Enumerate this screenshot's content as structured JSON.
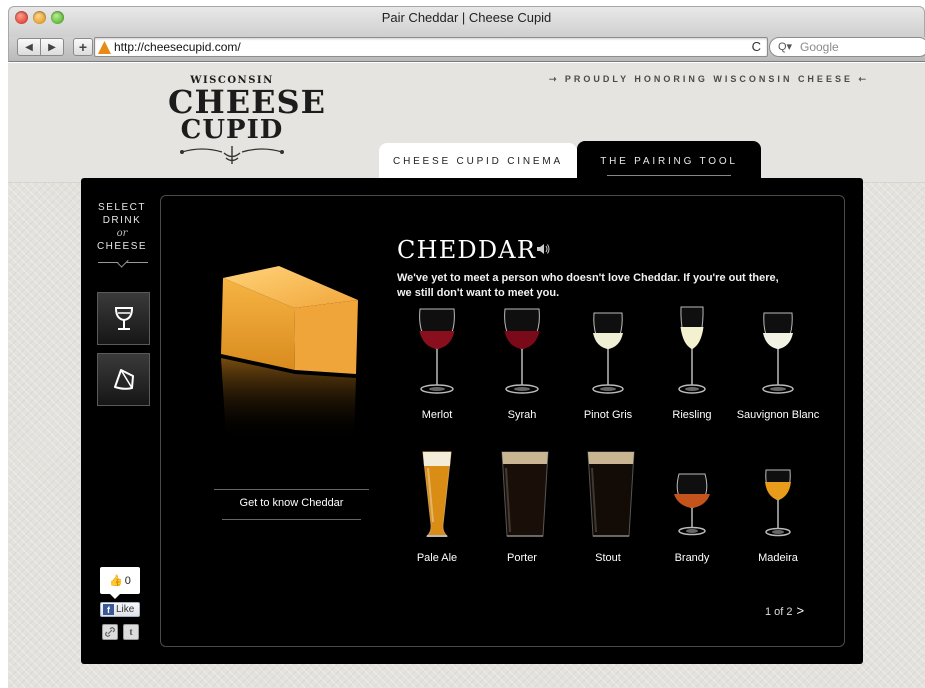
{
  "window": {
    "title": "Pair Cheddar | Cheese Cupid"
  },
  "browser": {
    "back_label": "◀",
    "forward_label": "▶",
    "add_label": "+",
    "url": "http://cheesecupid.com/",
    "reload_label": "C",
    "search_placeholder": "Google",
    "search_glyph": "Q▾"
  },
  "header": {
    "logo": {
      "line1": "WISCONSIN",
      "line2": "CHEESE",
      "line3": "CUPID"
    },
    "tagline": "PROUDLY HONORING WISCONSIN CHEESE",
    "tabs": [
      {
        "label": "CHEESE CUPID CINEMA",
        "active": false
      },
      {
        "label": "THE PAIRING TOOL",
        "active": true
      }
    ]
  },
  "sidebar": {
    "select_line1": "SELECT",
    "select_line2": "DRINK",
    "select_or": "or",
    "select_line3": "CHEESE",
    "buttons": [
      {
        "icon": "wine-glass-icon"
      },
      {
        "icon": "cheese-wedge-icon"
      }
    ],
    "social": {
      "like_count": "0",
      "like_label": "Like",
      "share_link_glyph": "🔗",
      "twitter_glyph": "t"
    }
  },
  "cheese": {
    "name": "CHEDDAR",
    "description": "We've yet to meet a person who doesn't love Cheddar. If you're out there, we still don't want to meet you.",
    "know_button": "Get to know Cheddar",
    "color": "#f4a733"
  },
  "drinks": [
    {
      "label": "Merlot",
      "kind": "red-wine",
      "color": "#8a0f1e"
    },
    {
      "label": "Syrah",
      "kind": "red-wine",
      "color": "#7a0a1a"
    },
    {
      "label": "Pinot Gris",
      "kind": "white-wine",
      "color": "#efefd6"
    },
    {
      "label": "Riesling",
      "kind": "flute",
      "color": "#f3f1cf"
    },
    {
      "label": "Sauvignon Blanc",
      "kind": "white-wine",
      "color": "#f2f2e4"
    },
    {
      "label": "Pale Ale",
      "kind": "pilsner",
      "color": "#d98d14"
    },
    {
      "label": "Porter",
      "kind": "pint-dark",
      "color": "#1a0f08"
    },
    {
      "label": "Stout",
      "kind": "pint-dark",
      "color": "#120b06"
    },
    {
      "label": "Brandy",
      "kind": "snifter",
      "color": "#c4531c"
    },
    {
      "label": "Madeira",
      "kind": "small-wine",
      "color": "#e89c1a"
    }
  ],
  "pager": {
    "text": "1 of 2",
    "next": ">"
  }
}
